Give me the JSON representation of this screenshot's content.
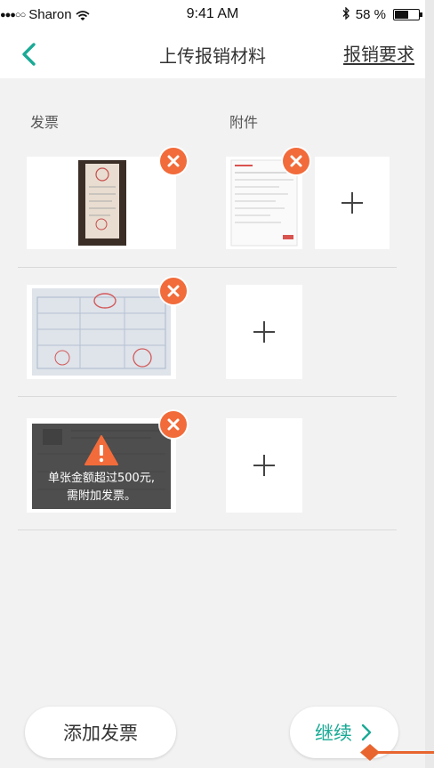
{
  "status_bar": {
    "signal": "●●●○○",
    "carrier": "Sharon",
    "time": "9:41 AM",
    "battery": "58 %"
  },
  "nav": {
    "title": "上传报销材料",
    "action": "报销要求"
  },
  "columns": {
    "invoice": "发票",
    "attachment": "附件"
  },
  "warning": {
    "line1": "单张金额超过500元,",
    "line2": "需附加发票。"
  },
  "bottom": {
    "add_invoice": "添加发票",
    "continue": "继续"
  },
  "colors": {
    "accent": "#1aaa96",
    "delete_badge": "#f26b3a",
    "pointer_arrow": "#e8652f"
  }
}
